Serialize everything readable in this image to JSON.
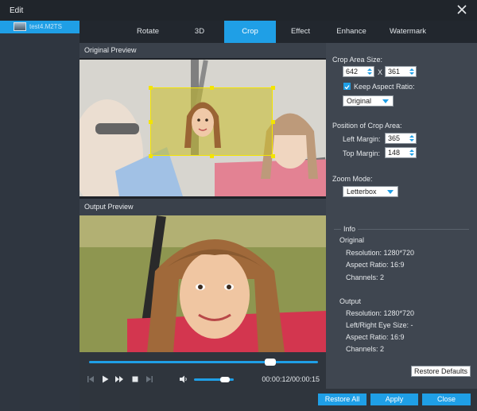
{
  "window": {
    "title": "Edit"
  },
  "file_list": {
    "items": [
      {
        "name": "test4.M2TS"
      }
    ]
  },
  "tabs": [
    "Rotate",
    "3D",
    "Crop",
    "Effect",
    "Enhance",
    "Watermark"
  ],
  "active_tab": "Crop",
  "original_preview": {
    "label": "Original Preview"
  },
  "output_preview": {
    "label": "Output Preview"
  },
  "player": {
    "time": "00:00:12/00:00:15",
    "seek_progress": 0.79,
    "volume_level": 0.78
  },
  "crop": {
    "section_label": "Crop Area Size:",
    "width": "642",
    "x_separator": "X",
    "height": "361",
    "keep_aspect_label": "Keep Aspect Ratio:",
    "keep_aspect_checked": true,
    "aspect_select": "Original",
    "position_label": "Position of Crop Area:",
    "left_margin_label": "Left Margin:",
    "left_margin": "365",
    "top_margin_label": "Top Margin:",
    "top_margin": "148",
    "zoom_label": "Zoom Mode:",
    "zoom_select": "Letterbox"
  },
  "info": {
    "header": "Info",
    "original": {
      "title": "Original",
      "resolution": "Resolution: 1280*720",
      "aspect": "Aspect Ratio: 16:9",
      "channels": "Channels: 2"
    },
    "output": {
      "title": "Output",
      "resolution": "Resolution: 1280*720",
      "eye_size": "Left/Right Eye Size: -",
      "aspect": "Aspect Ratio: 16:9",
      "channels": "Channels: 2"
    }
  },
  "buttons": {
    "restore_defaults": "Restore Defaults",
    "restore_all": "Restore All",
    "apply": "Apply",
    "close": "Close"
  },
  "colors": {
    "accent": "#1f9fe6",
    "crop_frame": "#f3e400",
    "panel": "#3f4650",
    "background": "#1f2329"
  }
}
